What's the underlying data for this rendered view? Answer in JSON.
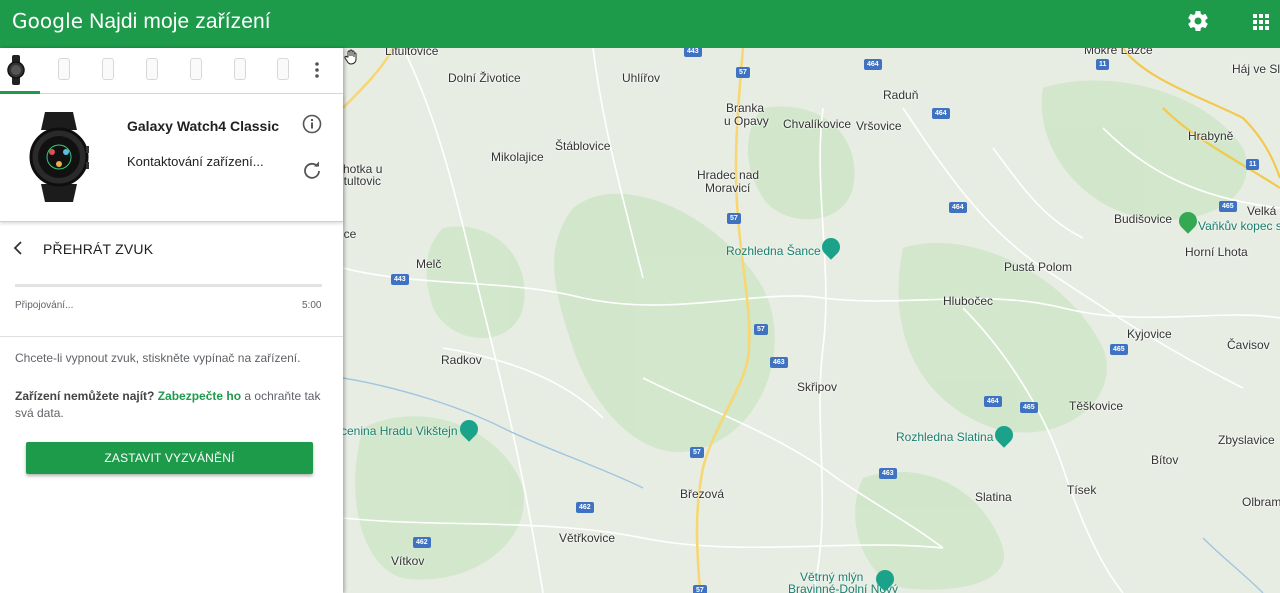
{
  "header": {
    "brand": "Google",
    "title": "Najdi moje zařízení"
  },
  "device": {
    "name": "Galaxy Watch4 Classic",
    "status": "Kontaktování zařízení..."
  },
  "action": {
    "title": "PŘEHRÁT ZVUK",
    "progress_label": "Připojování...",
    "time": "5:00",
    "hint": "Chcete-li vypnout zvuk, stiskněte vypínač na zařízení.",
    "secure_prefix": "Zařízení nemůžete najít?",
    "secure_link": "Zabezpečte ho",
    "secure_suffix": "a ochraňte tak svá data.",
    "stop_button": "ZASTAVIT VYZVÁNĚNÍ"
  },
  "map": {
    "towns": {
      "litultovice": "Litultovice",
      "dolni_zivotice": "Dolní Životice",
      "uhlirov": "Uhlířov",
      "branka": "Branka",
      "u_opavy": "u Opavy",
      "chvalikovice": "Chvalíkovice",
      "vrsovice": "Vršovice",
      "radun": "Raduň",
      "mokre_lazce": "Mokré Lazce",
      "haj_ve_sl": "Háj ve Sl",
      "hrabyne": "Hrabyně",
      "stablovice": "Štáblovice",
      "mikolajice": "Mikolajice",
      "hradec_nad": "Hradec nad",
      "moravici": "Moravicí",
      "hotka": "hotka u",
      "tultovic": "itultovic",
      "budisovice": "Budišovice",
      "velka": "Velká",
      "horni_lhota": "Horní Lhota",
      "ice": "ice",
      "melc": "Melč",
      "pusta_polom": "Pustá Polom",
      "hlubocec": "Hlubočec",
      "kyjovice": "Kyjovice",
      "cavisov": "Čavisov",
      "radkov": "Radkov",
      "skripov": "Skřipov",
      "teskovice": "Těškovice",
      "zbyslavice": "Zbyslavice",
      "bitov": "Bítov",
      "slatina": "Slatina",
      "tisek": "Tísek",
      "olbram": "Olbram",
      "brezova": "Březová",
      "vetrkovice": "Větřkovice",
      "vitkov": "Vítkov"
    },
    "pois": {
      "sance": "Rozhledna Šance",
      "vankuv": "Vaňkův kopec s",
      "vikstejn": "cenina Hradu Vikštejn",
      "slatina": "Rozhledna Slatina",
      "vetrny_1": "Větrný mlýn",
      "vetrny_2": "Bravinné-Dolní Nový"
    },
    "roads": {
      "r443a": "443",
      "r57a": "57",
      "r464a": "464",
      "r11a": "11",
      "r464b": "464",
      "r11b": "11",
      "r464c": "464",
      "r465a": "465",
      "r57b": "57",
      "r443b": "443",
      "r57c": "57",
      "r463a": "463",
      "r465b": "465",
      "r464d": "464",
      "r465c": "465",
      "r57d": "57",
      "r463b": "463",
      "r462a": "462",
      "r462b": "462",
      "r57e": "57"
    }
  },
  "colors": {
    "brand_green": "#1e9a4b",
    "road_shield": "#3f73c2"
  }
}
